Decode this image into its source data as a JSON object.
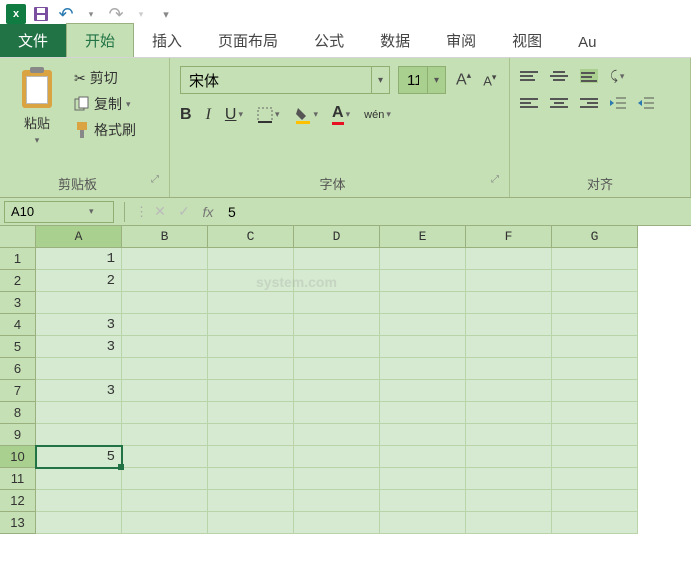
{
  "qat": {
    "undo": "↶",
    "redo": "↷"
  },
  "tabs": {
    "file": "文件",
    "home": "开始",
    "insert": "插入",
    "layout": "页面布局",
    "formula": "公式",
    "data": "数据",
    "review": "审阅",
    "view": "视图",
    "au": "Au"
  },
  "ribbon": {
    "clipboard": {
      "label": "剪贴板",
      "paste": "粘贴",
      "cut": "剪切",
      "copy": "复制",
      "format": "格式刷"
    },
    "font": {
      "label": "字体",
      "name": "宋体",
      "size": "11",
      "bold": "B",
      "italic": "I",
      "underline": "U",
      "wen": "wén"
    },
    "align": {
      "label": "对齐"
    }
  },
  "formula_bar": {
    "name_box": "A10",
    "fx": "fx",
    "value": "5"
  },
  "grid": {
    "columns": [
      "A",
      "B",
      "C",
      "D",
      "E",
      "F",
      "G"
    ],
    "rows": [
      "1",
      "2",
      "3",
      "4",
      "5",
      "6",
      "7",
      "8",
      "9",
      "10",
      "11",
      "12",
      "13"
    ],
    "active": {
      "row": 10,
      "col": "A"
    },
    "data": {
      "A1": "1",
      "A2": "2",
      "A4": "3",
      "A5": "3",
      "A7": "3",
      "A10": "5"
    }
  },
  "watermark": {
    "line1": "",
    "line2": "system.com"
  },
  "chart_data": {
    "type": "table",
    "columns": [
      "A"
    ],
    "rows": [
      {
        "row": 1,
        "A": 1
      },
      {
        "row": 2,
        "A": 2
      },
      {
        "row": 3,
        "A": null
      },
      {
        "row": 4,
        "A": 3
      },
      {
        "row": 5,
        "A": 3
      },
      {
        "row": 6,
        "A": null
      },
      {
        "row": 7,
        "A": 3
      },
      {
        "row": 8,
        "A": null
      },
      {
        "row": 9,
        "A": null
      },
      {
        "row": 10,
        "A": 5
      },
      {
        "row": 11,
        "A": null
      },
      {
        "row": 12,
        "A": null
      },
      {
        "row": 13,
        "A": null
      }
    ]
  }
}
